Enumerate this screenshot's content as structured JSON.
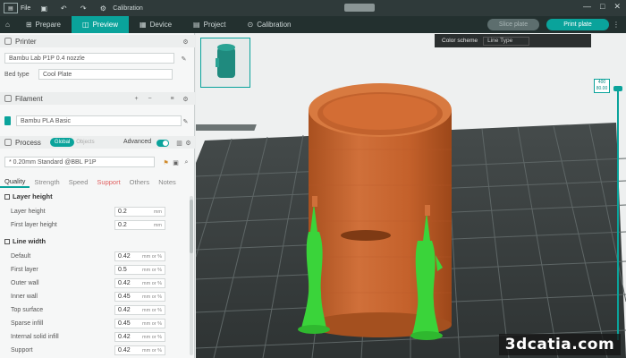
{
  "titlebar": {
    "menu_label": "File",
    "document_title": "Calibration"
  },
  "tabs": [
    {
      "label": "Prepare"
    },
    {
      "label": "Preview"
    },
    {
      "label": "Device"
    },
    {
      "label": "Project"
    },
    {
      "label": "Calibration"
    }
  ],
  "actions": {
    "slice_label": "Slice plate",
    "print_label": "Print plate"
  },
  "printer": {
    "section_title": "Printer",
    "printer_value": "Bambu Lab P1P 0.4 nozzle",
    "bed_type_label": "Bed type",
    "bed_type_value": "Cool Plate"
  },
  "filament": {
    "section_title": "Filament",
    "item_value": "Bambu PLA Basic"
  },
  "process": {
    "section_title": "Process",
    "global_label": "Global",
    "objects_label": "Objects",
    "advanced_label": "Advanced",
    "preset_value": "* 0.20mm Standard @BBL P1P"
  },
  "subtabs": [
    "Quality",
    "Strength",
    "Speed",
    "Support",
    "Others",
    "Notes"
  ],
  "layer_height": {
    "title": "Layer height",
    "params": [
      {
        "label": "Layer height",
        "value": "0.2",
        "unit": "mm"
      },
      {
        "label": "First layer height",
        "value": "0.2",
        "unit": "mm"
      }
    ]
  },
  "line_width": {
    "title": "Line width",
    "params": [
      {
        "label": "Default",
        "value": "0.42",
        "unit": "mm or %"
      },
      {
        "label": "First layer",
        "value": "0.5",
        "unit": "mm or %"
      },
      {
        "label": "Outer wall",
        "value": "0.42",
        "unit": "mm or %"
      },
      {
        "label": "Inner wall",
        "value": "0.45",
        "unit": "mm or %"
      },
      {
        "label": "Top surface",
        "value": "0.42",
        "unit": "mm or %"
      },
      {
        "label": "Sparse infill",
        "value": "0.45",
        "unit": "mm or %"
      },
      {
        "label": "Internal solid infill",
        "value": "0.42",
        "unit": "mm or %"
      },
      {
        "label": "Support",
        "value": "0.42",
        "unit": "mm or %"
      }
    ]
  },
  "viewport": {
    "color_scheme_label": "Color scheme",
    "color_scheme_value": "Line Type",
    "layer_top_label": "400",
    "layer_top_height": "80.00"
  },
  "watermark": "3dcatia.com",
  "colors": {
    "accent": "#0aa39b",
    "model_orange": "#c8642c",
    "support_green": "#3ad43a",
    "plate_dark": "#3a3f3f"
  }
}
